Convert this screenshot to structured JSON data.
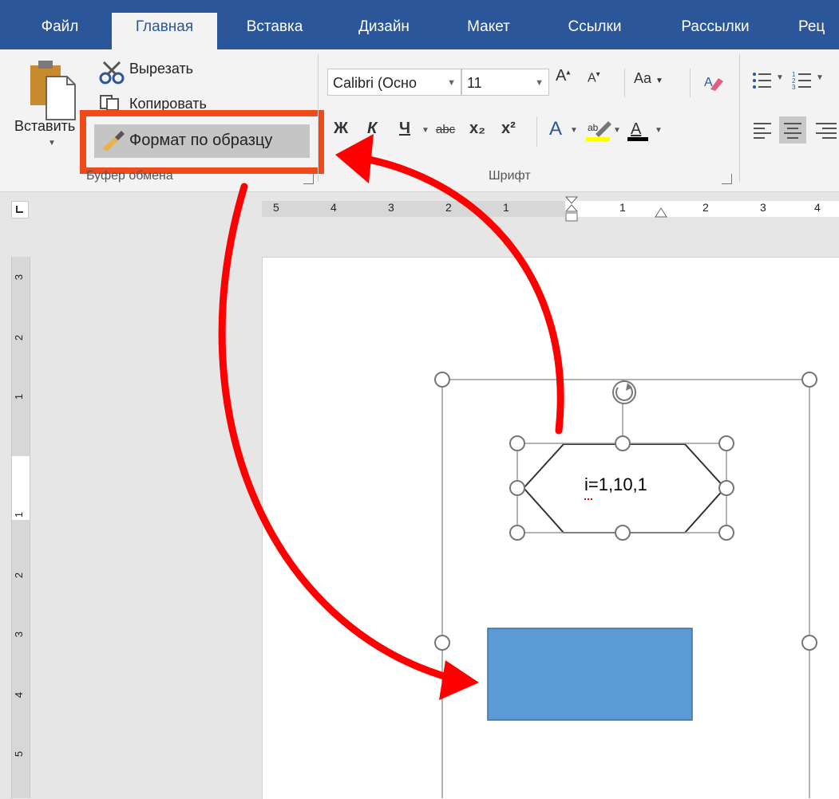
{
  "tabs": [
    {
      "label": "Файл"
    },
    {
      "label": "Главная"
    },
    {
      "label": "Вставка"
    },
    {
      "label": "Дизайн"
    },
    {
      "label": "Макет"
    },
    {
      "label": "Ссылки"
    },
    {
      "label": "Рассылки"
    },
    {
      "label": "Рец"
    }
  ],
  "clipboard": {
    "paste_label": "Вставить",
    "cut_label": "Вырезать",
    "copy_label": "Копировать",
    "format_painter_label": "Формат по образцу",
    "group_label": "Буфер обмена"
  },
  "font": {
    "font_name": "Calibri (Осно",
    "font_size": "11",
    "change_case_label": "Aa",
    "bold": "Ж",
    "italic": "К",
    "underline": "Ч",
    "strike": "abc",
    "subscript": "x₂",
    "superscript": "x²",
    "group_label": "Шрифт"
  },
  "ruler_h": {
    "labels": [
      "5",
      "4",
      "3",
      "2",
      "1",
      "1",
      "2",
      "3",
      "4"
    ]
  },
  "ruler_v": {
    "labels": [
      "3",
      "2",
      "1",
      "1",
      "2",
      "3",
      "4",
      "5"
    ]
  },
  "document": {
    "hexagon_text": "i=1,10,1",
    "rect_fill": "#5b9bd5"
  },
  "annotation_color": "#ff0000",
  "highlight_color": "#f04a1a"
}
